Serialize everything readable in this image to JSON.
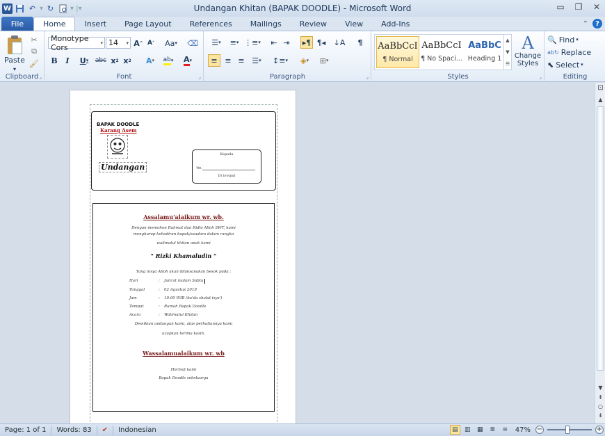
{
  "window": {
    "title": "Undangan Khitan (BAPAK DOODLE)  -  Microsoft Word"
  },
  "tabs": [
    {
      "label": "File"
    },
    {
      "label": "Home"
    },
    {
      "label": "Insert"
    },
    {
      "label": "Page Layout"
    },
    {
      "label": "References"
    },
    {
      "label": "Mailings"
    },
    {
      "label": "Review"
    },
    {
      "label": "View"
    },
    {
      "label": "Add-Ins"
    }
  ],
  "ribbon": {
    "clipboard": {
      "label": "Clipboard",
      "paste": "Paste"
    },
    "font": {
      "label": "Font",
      "name": "Monotype Cors",
      "size": "14",
      "change_case": "Aa"
    },
    "paragraph": {
      "label": "Paragraph"
    },
    "styles": {
      "label": "Styles",
      "items": [
        {
          "sample": "AaBbCcI",
          "name": "¶ Normal"
        },
        {
          "sample": "AaBbCcI",
          "name": "¶ No Spaci..."
        },
        {
          "sample": "AaBbC",
          "name": "Heading 1"
        }
      ],
      "change_styles": "Change Styles"
    },
    "editing": {
      "label": "Editing",
      "find": "Find",
      "replace": "Replace",
      "select": "Select"
    }
  },
  "document": {
    "org_name": "BAPAK DOODLE",
    "org_place": "Karang Asem",
    "heading": "Undangan",
    "address": {
      "to": "Kepada",
      "yth": "Yth.",
      "at": "Di tempat"
    },
    "letter": {
      "greeting": "Assalamu'alaikum wr. wb.",
      "intro_1": "Dengan memohon Rahmat dan Ridlo Alloh SWT, kami",
      "intro_2": "mengharap kehadiran bapak/saudara dalam rangka",
      "intro_3": "walimatul khitan anak kami",
      "child_name": "\" Rizki Khamaludin \"",
      "schedule_intro": "Yang insya Alloh akan dilaksanakan besok pada :",
      "rows": [
        {
          "key": "Hari",
          "value": "Jum'at malam Sabtu"
        },
        {
          "key": "Tanggal",
          "value": "02 Agustus 2019"
        },
        {
          "key": "Jam",
          "value": "19.00 WIB (ba'da sholat isya')"
        },
        {
          "key": "Tempat",
          "value": "Rumah Bapak Doodle"
        },
        {
          "key": "Acara",
          "value": "Walimatul Khitan"
        }
      ],
      "closing_1": "Demikian undangan kami, atas perhatiannya kami",
      "closing_2": "ucapkan terima kasih.",
      "closing_greeting": "Wassalamualaikum wr. wb",
      "regards": "Hormat kami",
      "sender": "Bapak Doodle sekeluarga"
    }
  },
  "status": {
    "page": "Page: 1 of 1",
    "words": "Words: 83",
    "language": "Indonesian",
    "zoom": "47%"
  }
}
